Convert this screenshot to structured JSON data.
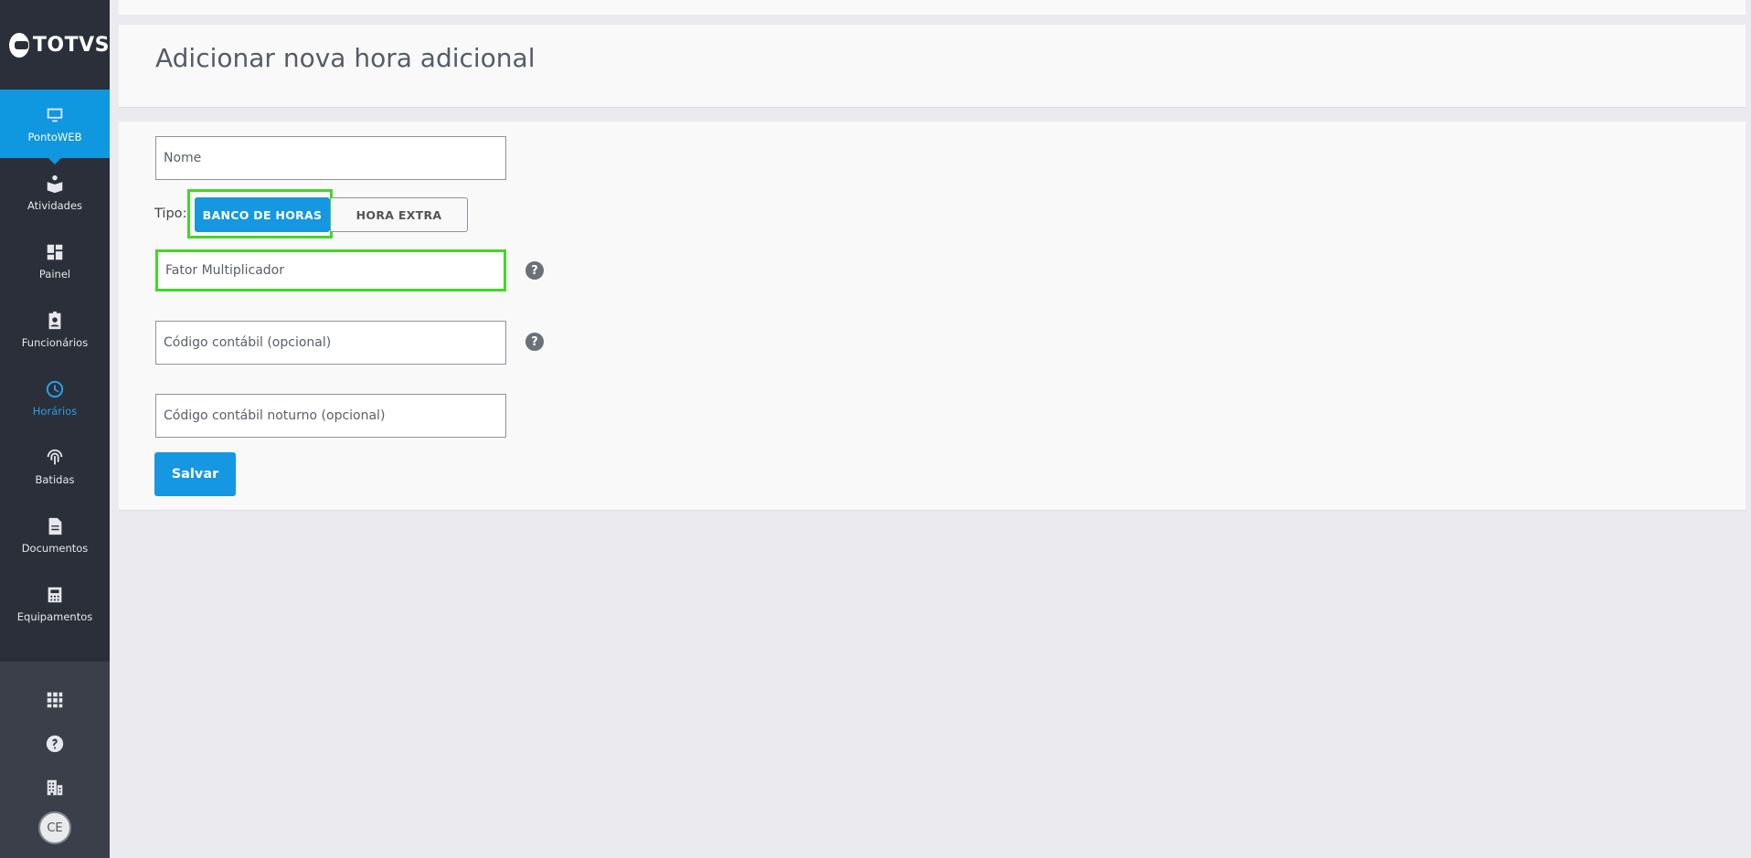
{
  "brand": {
    "name": "TOTVS"
  },
  "sidebar": {
    "items": [
      {
        "label": "PontoWEB",
        "icon": "monitor-icon"
      },
      {
        "label": "Atividades",
        "icon": "activity-icon"
      },
      {
        "label": "Painel",
        "icon": "dashboard-icon"
      },
      {
        "label": "Funcionários",
        "icon": "badge-icon"
      },
      {
        "label": "Horários",
        "icon": "clock-icon"
      },
      {
        "label": "Batidas",
        "icon": "fingerprint-icon"
      },
      {
        "label": "Documentos",
        "icon": "document-icon"
      },
      {
        "label": "Equipamentos",
        "icon": "device-icon"
      }
    ],
    "bottom": {
      "apps_icon": "apps-grid-icon",
      "help_icon": "help-icon",
      "company_icon": "building-icon",
      "avatar_initials": "CE"
    }
  },
  "header": {
    "title": "Adicionar nova hora adicional"
  },
  "form": {
    "nome_placeholder": "Nome",
    "tipo_label": "Tipo:",
    "tipo_options": [
      "BANCO DE HORAS",
      "HORA EXTRA"
    ],
    "tipo_selected": "BANCO DE HORAS",
    "fator_placeholder": "Fator Multiplicador",
    "codigo_placeholder": "Código contábil (opcional)",
    "codigo_noturno_placeholder": "Código contábil noturno (opcional)",
    "help_glyph": "?",
    "save_label": "Salvar"
  },
  "colors": {
    "accent": "#1597e1",
    "sidebar_bg": "#2b2f39",
    "highlight_outline": "#43d628",
    "active_nav_text": "#2aa0e6"
  }
}
